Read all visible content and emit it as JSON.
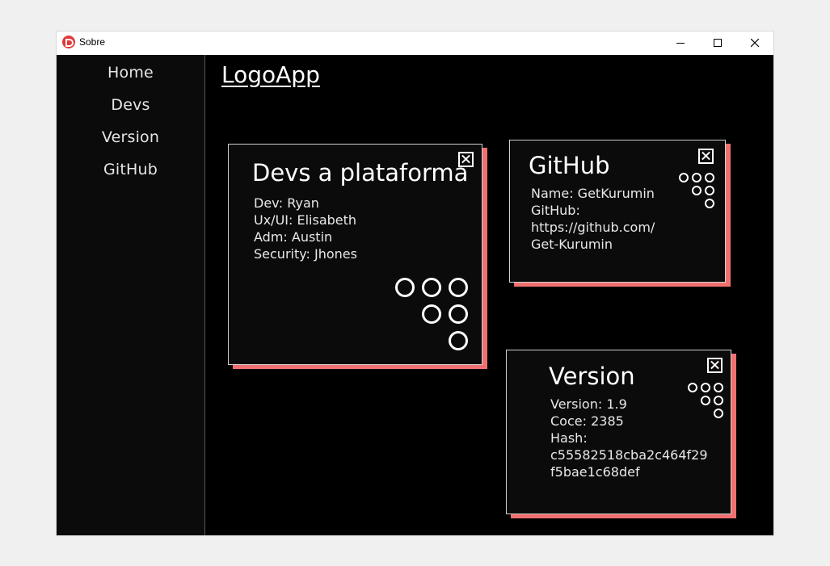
{
  "window": {
    "title": "Sobre"
  },
  "sidebar": {
    "items": [
      {
        "label": "Home"
      },
      {
        "label": "Devs"
      },
      {
        "label": "Version"
      },
      {
        "label": "GitHub"
      }
    ]
  },
  "header": {
    "logo": "LogoApp"
  },
  "cards": {
    "devs": {
      "title": "Devs a plataforma",
      "lines": [
        "Dev: Ryan",
        "Ux/UI: Elisabeth",
        "Adm: Austin",
        "Security: Jhones"
      ]
    },
    "github": {
      "title": "GitHub",
      "lines": [
        "Name: GetKurumin",
        "GitHub:",
        "https://github.com/",
        "Get-Kurumin"
      ]
    },
    "version": {
      "title": "Version",
      "lines": [
        "Version: 1.9",
        "Coce: 2385",
        "Hash:",
        "c55582518cba2c464f29",
        "f5bae1c68def"
      ]
    }
  },
  "colors": {
    "accent": "#f07070",
    "background": "#000000",
    "sidebar": "#0b0b0b"
  },
  "icons": [
    "app-icon",
    "minimize-icon",
    "maximize-icon",
    "close-icon",
    "card-close-icon",
    "dots-pattern-icon"
  ]
}
